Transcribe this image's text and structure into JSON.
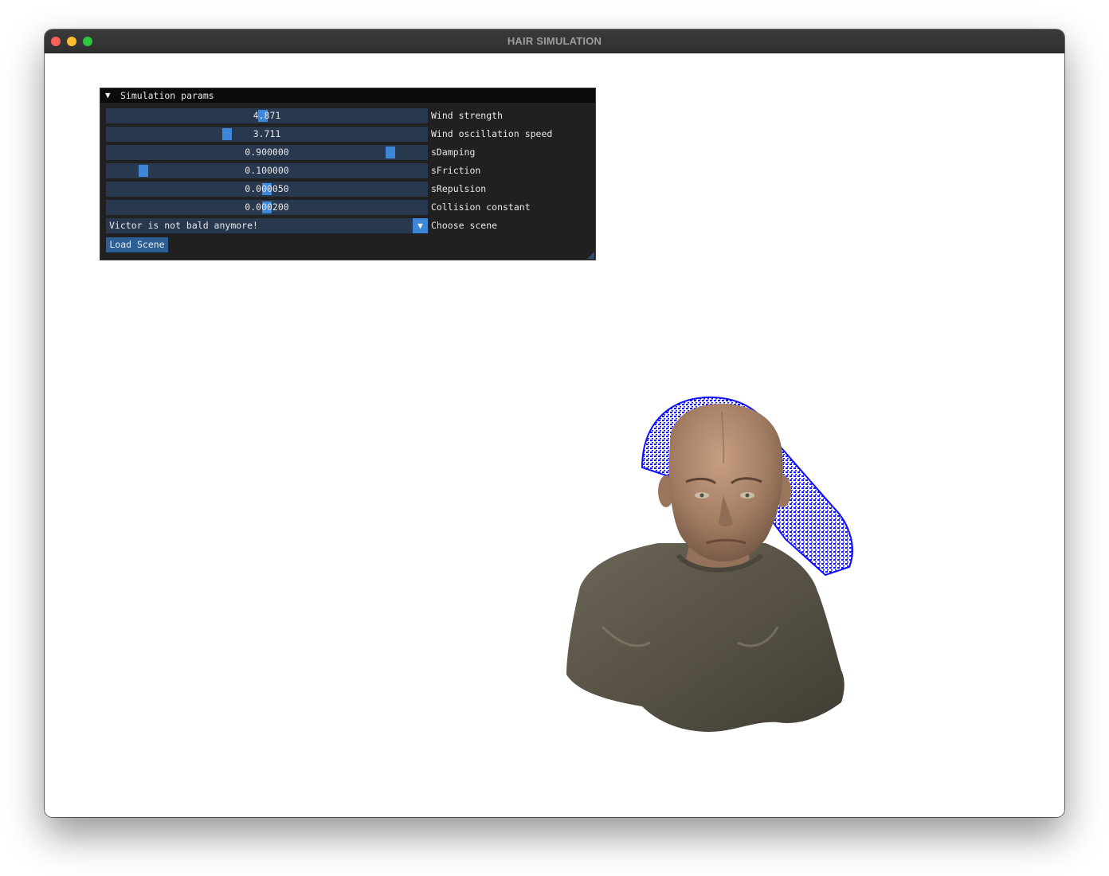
{
  "window": {
    "title": "HAIR SIMULATION"
  },
  "panel": {
    "title": "Simulation params",
    "sliders": [
      {
        "label": "Wind strength",
        "value": "4.871",
        "level": 0.487
      },
      {
        "label": "Wind oscillation speed",
        "value": "3.711",
        "level": 0.371
      },
      {
        "label": "sDamping",
        "value": "0.900000",
        "level": 0.9
      },
      {
        "label": "sFriction",
        "value": "0.100000",
        "level": 0.1
      },
      {
        "label": "sRepulsion",
        "value": "0.000050",
        "level": 0.5
      },
      {
        "label": "Collision constant",
        "value": "0.000200",
        "level": 0.5
      }
    ],
    "combo": {
      "label": "Choose scene",
      "value": "Victor is not bald anymore!"
    },
    "load_button": "Load Scene"
  },
  "colors": {
    "hair": "#1010ff",
    "shirt": "#5f5a4c",
    "skin": "#b08a70",
    "slider_bg": "#28384f",
    "slider_grab": "#3d86d8"
  },
  "icons": {
    "collapse": "triangle-down-icon",
    "combo": "triangle-down-icon"
  }
}
